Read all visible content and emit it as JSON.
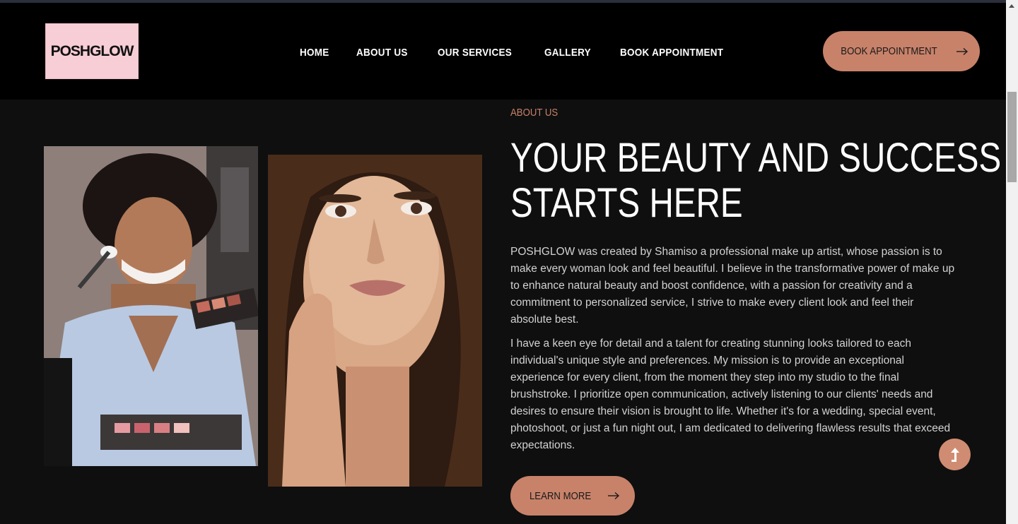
{
  "brand": {
    "logo_text": "POSHGLOW"
  },
  "nav": {
    "items": [
      {
        "label": "HOME"
      },
      {
        "label": "ABOUT US"
      },
      {
        "label": "OUR SERVICES"
      },
      {
        "label": "GALLERY"
      },
      {
        "label": "BOOK APPOINTMENT"
      }
    ],
    "cta_label": "BOOK APPOINTMENT"
  },
  "about": {
    "eyebrow": "ABOUT US",
    "headline_line1": "YOUR BEAUTY AND SUCCESS",
    "headline_line2": "STARTS HERE",
    "paragraph1": "POSHGLOW was created by Shamiso a professional make up artist, whose passion is to make every woman look and feel beautiful. I believe in the transformative power of make up to enhance natural beauty and boost confidence, with a passion for creativity and a commitment to personalized service, I strive to make every client look and feel their absolute best.",
    "paragraph2": "I have a keen eye for detail and a talent for creating stunning looks tailored to each individual's unique style and preferences. My mission is to provide an exceptional experience for every client, from the moment they step into my studio to the final brushstroke. I prioritize open communication, actively listening to our clients' needs and desires to ensure their vision is brought to life. Whether it's for a wedding, special event, photoshoot, or just a fun night out, I am dedicated to delivering flawless results that exceed expectations.",
    "button_label": "LEARN MORE"
  },
  "icons": {
    "cta_arrow": "arrow-right-icon",
    "learn_arrow": "arrow-right-icon",
    "scroll_top": "arrow-up-icon"
  },
  "colors": {
    "accent": "#c8826a",
    "logo_bg": "#f7cdd6",
    "header_bg": "#000000",
    "page_bg": "#0f0f0f"
  }
}
